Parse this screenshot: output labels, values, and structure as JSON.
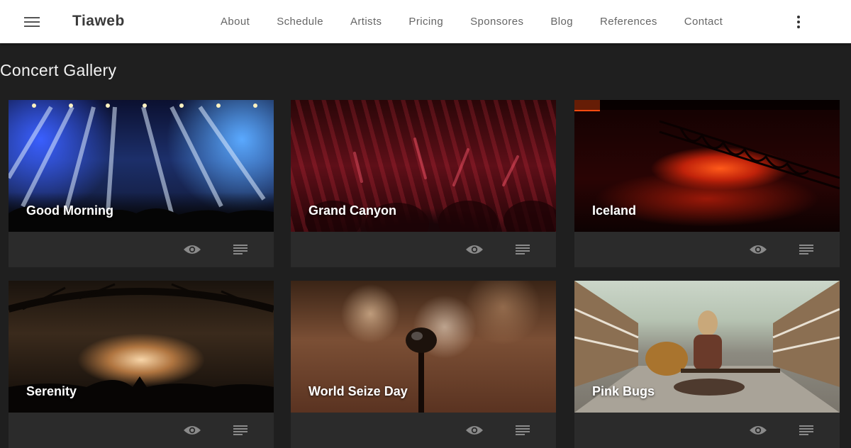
{
  "header": {
    "brand": "Tiaweb",
    "nav": [
      "About",
      "Schedule",
      "Artists",
      "Pricing",
      "Sponsores",
      "Blog",
      "References",
      "Contact"
    ]
  },
  "page": {
    "title": "Concert Gallery"
  },
  "gallery": [
    {
      "title": "Good Morning"
    },
    {
      "title": "Grand Canyon"
    },
    {
      "title": "Iceland"
    },
    {
      "title": "Serenity"
    },
    {
      "title": "World Seize Day"
    },
    {
      "title": "Pink Bugs"
    }
  ],
  "icons": {
    "menu": "hamburger-menu-icon",
    "more": "more-vertical-icon",
    "view": "eye-icon",
    "details": "subject-lines-icon"
  },
  "colors": {
    "background": "#1f1f1f",
    "card": "#2b2b2b",
    "appbar": "#ffffff"
  }
}
